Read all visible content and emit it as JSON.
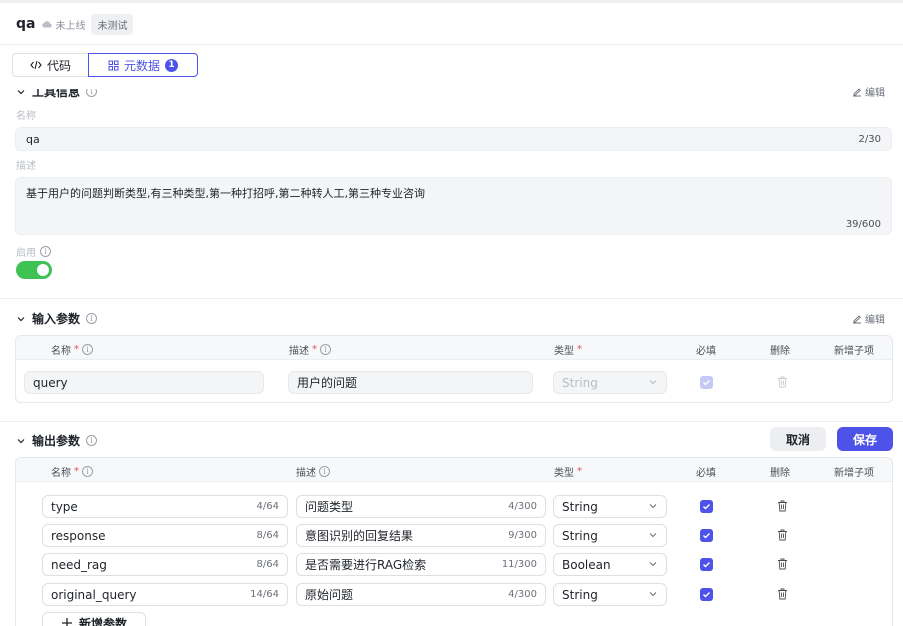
{
  "header": {
    "title": "qa",
    "status": "未上线",
    "badge": "未测试"
  },
  "tabs": [
    {
      "label": "代码",
      "icon": "code-icon"
    },
    {
      "label": "元数据",
      "icon": "metadata-grid-icon",
      "dot": "1"
    }
  ],
  "tool_info": {
    "title": "工具信息",
    "edit_label": "编辑",
    "name_label": "名称",
    "name_value": "qa",
    "name_count": "2/30",
    "desc_label": "描述",
    "desc_value": "基于用户的问题判断类型,有三种类型,第一种打招呼,第二种转人工,第三种专业咨询",
    "desc_count": "39/600",
    "enable_label": "启用",
    "enabled": true
  },
  "input_params": {
    "title": "输入参数",
    "edit_label": "编辑",
    "columns": {
      "name": "名称",
      "desc": "描述",
      "type": "类型",
      "required": "必填",
      "delete": "删除",
      "add_child": "新增子项"
    },
    "rows": [
      {
        "name": "query",
        "desc": "用户的问题",
        "type": "String",
        "required": true
      }
    ]
  },
  "output_params": {
    "title": "输出参数",
    "cancel_label": "取消",
    "save_label": "保存",
    "columns": {
      "name": "名称",
      "desc": "描述",
      "type": "类型",
      "required": "必填",
      "delete": "删除",
      "add_child": "新增子项"
    },
    "rows": [
      {
        "name": "type",
        "name_count": "4/64",
        "desc": "问题类型",
        "desc_count": "4/300",
        "type": "String",
        "required": true
      },
      {
        "name": "response",
        "name_count": "8/64",
        "desc": "意图识别的回复结果",
        "desc_count": "9/300",
        "type": "String",
        "required": true
      },
      {
        "name": "need_rag",
        "name_count": "8/64",
        "desc": "是否需要进行RAG检索",
        "desc_count": "11/300",
        "type": "Boolean",
        "required": true
      },
      {
        "name": "original_query",
        "name_count": "14/64",
        "desc": "原始问题",
        "desc_count": "4/300",
        "type": "String",
        "required": true
      }
    ],
    "add_label": "新增参数"
  },
  "colors": {
    "accent": "#4d53e8",
    "toggle_on": "#3ec254",
    "required_star": "#e34d59"
  }
}
